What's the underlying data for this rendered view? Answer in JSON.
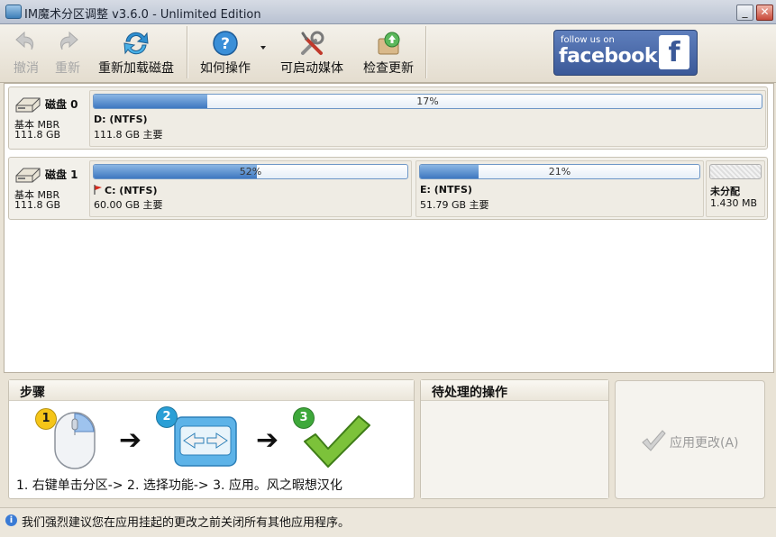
{
  "window": {
    "title": "IM魔术分区调整 v3.6.0 - Unlimited Edition",
    "minimize_label": "_",
    "close_label": "✕"
  },
  "toolbar": {
    "undo_label": "撤消",
    "redo_label": "重新",
    "reload_label": "重新加载磁盘",
    "howto_label": "如何操作",
    "bootable_label": "可启动媒体",
    "update_label": "检查更新",
    "facebook": {
      "line1": "follow us on",
      "line2": "facebook",
      "box": "f"
    }
  },
  "disks": [
    {
      "name": "磁盘 0",
      "type": "基本 MBR",
      "size": "111.8 GB",
      "partitions": [
        {
          "label": "D: (NTFS)",
          "size": "111.8 GB 主要",
          "used_pct": 17,
          "pct_label": "17%"
        }
      ]
    },
    {
      "name": "磁盘 1",
      "type": "基本 MBR",
      "size": "111.8 GB",
      "partitions": [
        {
          "label": "C: (NTFS)",
          "size": "60.00 GB 主要",
          "used_pct": 52,
          "pct_label": "52%",
          "flag": true
        },
        {
          "label": "E: (NTFS)",
          "size": "51.79 GB 主要",
          "used_pct": 21,
          "pct_label": "21%"
        },
        {
          "label": "未分配",
          "size": "1.430 MB",
          "unallocated": true
        }
      ]
    }
  ],
  "steps_panel": {
    "title": "步骤",
    "badges": [
      "1",
      "2",
      "3"
    ],
    "arrow": "➔",
    "text": "1. 右键单击分区-> 2. 选择功能-> 3. 应用。风之暇想汉化"
  },
  "pending_panel": {
    "title": "待处理的操作"
  },
  "apply_button": {
    "label": "应用更改(A)"
  },
  "status": {
    "info_icon_glyph": "i",
    "text": "我们强烈建议您在应用挂起的更改之前关闭所有其他应用程序。"
  },
  "colors": {
    "bar_fill": "#3e78c0",
    "facebook": "#3b5998",
    "badge1": "#f5c518",
    "badge2": "#2a9fd6",
    "badge3": "#3ea83a"
  }
}
